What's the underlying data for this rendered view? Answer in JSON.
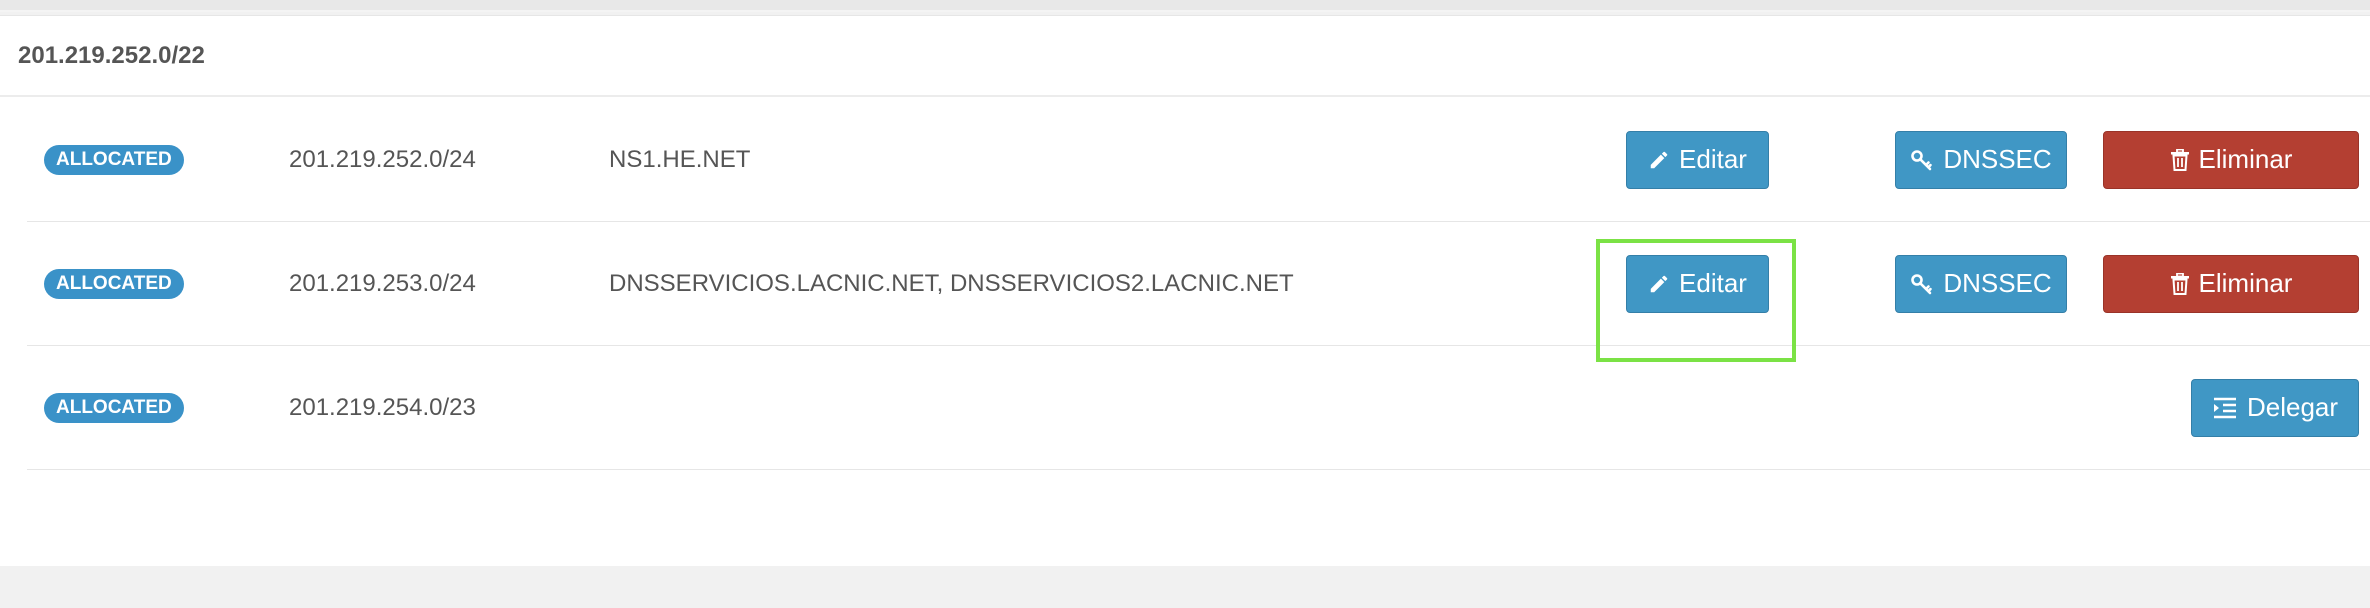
{
  "block": {
    "title": "201.219.252.0/22"
  },
  "rows": [
    {
      "status": "ALLOCATED",
      "prefix": "201.219.252.0/24",
      "nameservers": "NS1.HE.NET",
      "edit_label": "Editar",
      "dnssec_label": "DNSSEC",
      "delete_label": "Eliminar"
    },
    {
      "status": "ALLOCATED",
      "prefix": "201.219.253.0/24",
      "nameservers": "DNSSERVICIOS.LACNIC.NET, DNSSERVICIOS2.LACNIC.NET",
      "edit_label": "Editar",
      "dnssec_label": "DNSSEC",
      "delete_label": "Eliminar"
    },
    {
      "status": "ALLOCATED",
      "prefix": "201.219.254.0/23",
      "delegate_label": "Delegar"
    }
  ],
  "colors": {
    "primary_button": "#4097c5",
    "danger_button": "#b43f32",
    "badge": "#3a92c8",
    "highlight": "#7be245"
  },
  "icons": {
    "edit": "pencil-icon",
    "dnssec": "key-icon",
    "delete": "trash-icon",
    "delegate": "list-indent-icon"
  }
}
